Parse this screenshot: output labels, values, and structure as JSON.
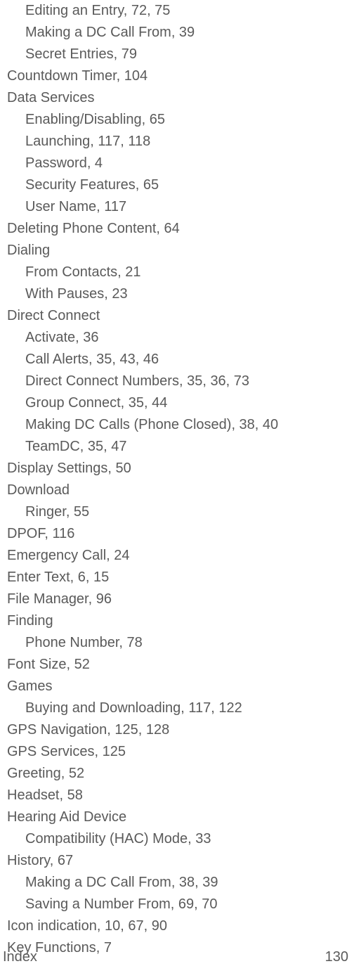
{
  "footer": {
    "label": "Index",
    "page": "130"
  },
  "entries": [
    {
      "level": 1,
      "text": "Editing an Entry, 72, 75"
    },
    {
      "level": 1,
      "text": "Making a DC Call From, 39"
    },
    {
      "level": 1,
      "text": "Secret Entries, 79"
    },
    {
      "level": 0,
      "text": "Countdown Timer, 104"
    },
    {
      "level": 0,
      "text": "Data Services"
    },
    {
      "level": 1,
      "text": "Enabling/Disabling, 65"
    },
    {
      "level": 1,
      "text": "Launching, 117, 118"
    },
    {
      "level": 1,
      "text": "Password, 4"
    },
    {
      "level": 1,
      "text": "Security Features, 65"
    },
    {
      "level": 1,
      "text": "User Name, 117"
    },
    {
      "level": 0,
      "text": "Deleting Phone Content, 64"
    },
    {
      "level": 0,
      "text": "Dialing"
    },
    {
      "level": 1,
      "text": "From Contacts, 21"
    },
    {
      "level": 1,
      "text": "With Pauses, 23"
    },
    {
      "level": 0,
      "text": "Direct Connect"
    },
    {
      "level": 1,
      "text": "Activate, 36"
    },
    {
      "level": 1,
      "text": "Call Alerts, 35, 43, 46"
    },
    {
      "level": 1,
      "text": "Direct Connect Numbers, 35, 36, 73"
    },
    {
      "level": 1,
      "text": "Group Connect, 35, 44"
    },
    {
      "level": 1,
      "text": "Making DC Calls (Phone Closed), 38, 40"
    },
    {
      "level": 1,
      "text": "TeamDC, 35, 47"
    },
    {
      "level": 0,
      "text": "Display Settings, 50"
    },
    {
      "level": 0,
      "text": "Download"
    },
    {
      "level": 1,
      "text": "Ringer, 55"
    },
    {
      "level": 0,
      "text": "DPOF, 116"
    },
    {
      "level": 0,
      "text": "Emergency Call, 24"
    },
    {
      "level": 0,
      "text": "Enter Text, 6, 15"
    },
    {
      "level": 0,
      "text": "File Manager, 96"
    },
    {
      "level": 0,
      "text": "Finding"
    },
    {
      "level": 1,
      "text": "Phone Number, 78"
    },
    {
      "level": 0,
      "text": "Font Size, 52"
    },
    {
      "level": 0,
      "text": "Games"
    },
    {
      "level": 1,
      "text": "Buying and Downloading, 117, 122"
    },
    {
      "level": 0,
      "text": "GPS Navigation, 125, 128"
    },
    {
      "level": 0,
      "text": "GPS Services, 125"
    },
    {
      "level": 0,
      "text": "Greeting, 52"
    },
    {
      "level": 0,
      "text": "Headset, 58"
    },
    {
      "level": 0,
      "text": "Hearing Aid Device"
    },
    {
      "level": 1,
      "text": "Compatibility (HAC) Mode, 33"
    },
    {
      "level": 0,
      "text": "History, 67"
    },
    {
      "level": 1,
      "text": "Making a DC Call From, 38, 39"
    },
    {
      "level": 1,
      "text": "Saving a Number From, 69, 70"
    },
    {
      "level": 0,
      "text": "Icon indication, 10, 67, 90"
    },
    {
      "level": 0,
      "text": "Key Functions, 7"
    }
  ]
}
